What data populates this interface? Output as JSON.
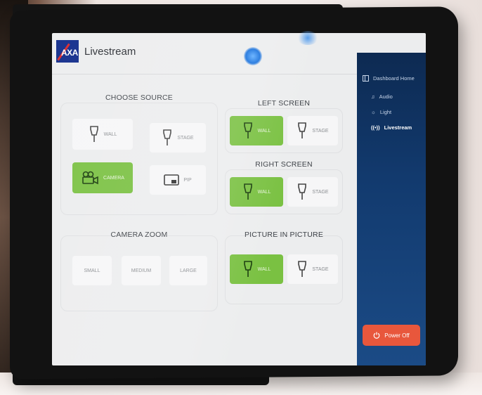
{
  "app": {
    "title": "Livestream",
    "logo_text": "AXA"
  },
  "choose_source": {
    "title": "CHOOSE SOURCE",
    "buttons": [
      {
        "label": "WALL",
        "active": false
      },
      {
        "label": "STAGE",
        "active": false
      },
      {
        "label": "CAMERA",
        "active": true
      },
      {
        "label": "PIP",
        "active": false
      }
    ]
  },
  "left_screen": {
    "title": "LEFT SCREEN",
    "wall": "WALL",
    "stage": "STAGE",
    "active": "WALL"
  },
  "right_screen": {
    "title": "RIGHT SCREEN",
    "wall": "WALL",
    "stage": "STAGE",
    "active": "WALL"
  },
  "camera_zoom": {
    "title": "CAMERA ZOOM",
    "small": "SMALL",
    "medium": "MEDIUM",
    "large": "LARGE"
  },
  "pip": {
    "title": "PICTURE IN PICTURE",
    "wall": "WALL",
    "stage": "STAGE",
    "active": "WALL"
  },
  "sidebar": {
    "items": [
      {
        "label": "Dashboard Home",
        "icon": "dashboard-icon"
      },
      {
        "label": "Audio",
        "icon": "music-note-icon"
      },
      {
        "label": "Light",
        "icon": "sun-icon"
      },
      {
        "label": "Livestream",
        "icon": "broadcast-icon",
        "active": true
      }
    ],
    "power_label": "Power Off"
  },
  "colors": {
    "active_green": "#7ac142",
    "sidebar_blue": "#123a6e",
    "power_red": "#e8573c"
  }
}
